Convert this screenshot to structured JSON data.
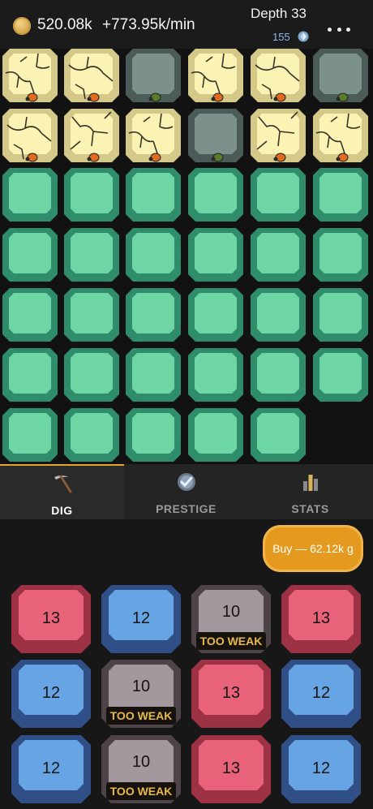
{
  "header": {
    "gold": "520.08k",
    "gold_rate": "+773.95k/min",
    "depth": "Depth 33",
    "gems": "155"
  },
  "mine": {
    "colors": {
      "emerald": "#6ed6a4",
      "cracked_sand": "#fbf3b4",
      "stone": "#7d918c",
      "background": "#121212"
    },
    "rows": [
      [
        "cracked_sand",
        "cracked_sand",
        "stone",
        "cracked_sand",
        "cracked_sand",
        "stone"
      ],
      [
        "cracked_sand",
        "cracked_sand",
        "cracked_sand",
        "stone",
        "cracked_sand",
        "cracked_sand"
      ],
      [
        "emerald",
        "emerald",
        "emerald",
        "emerald",
        "emerald",
        "emerald"
      ],
      [
        "emerald",
        "emerald",
        "emerald",
        "emerald",
        "emerald",
        "emerald"
      ],
      [
        "emerald",
        "emerald",
        "emerald",
        "emerald",
        "emerald",
        "emerald"
      ],
      [
        "emerald",
        "emerald",
        "emerald",
        "emerald",
        "emerald",
        "emerald"
      ],
      [
        "emerald",
        "emerald",
        "emerald",
        "emerald",
        "emerald"
      ]
    ],
    "critters": [
      {
        "row": 0,
        "col": 0,
        "kind": "orange-beetle"
      },
      {
        "row": 0,
        "col": 1,
        "kind": "orange-beetle"
      },
      {
        "row": 0,
        "col": 2,
        "kind": "green-beetle"
      },
      {
        "row": 0,
        "col": 3,
        "kind": "orange-beetle"
      },
      {
        "row": 0,
        "col": 4,
        "kind": "orange-beetle"
      },
      {
        "row": 0,
        "col": 5,
        "kind": "green-beetle"
      },
      {
        "row": 1,
        "col": 0,
        "kind": "orange-beetle"
      },
      {
        "row": 1,
        "col": 1,
        "kind": "orange-beetle"
      },
      {
        "row": 1,
        "col": 2,
        "kind": "orange-beetle"
      },
      {
        "row": 1,
        "col": 3,
        "kind": "green-beetle"
      },
      {
        "row": 1,
        "col": 4,
        "kind": "orange-beetle"
      },
      {
        "row": 1,
        "col": 5,
        "kind": "orange-beetle"
      }
    ]
  },
  "tabs": [
    {
      "label": "DIG",
      "icon": "pickaxe-icon",
      "active": true
    },
    {
      "label": "PRESTIGE",
      "icon": "prestige-badge-icon",
      "active": false
    },
    {
      "label": "STATS",
      "icon": "bar-chart-icon",
      "active": false
    }
  ],
  "dig": {
    "buy_label": "Buy — 62.12k g",
    "too_weak_label": "TOO WEAK",
    "pickaxes": [
      {
        "level": "13",
        "color": "red",
        "too_weak": false
      },
      {
        "level": "12",
        "color": "blue",
        "too_weak": false
      },
      {
        "level": "10",
        "color": "gray",
        "too_weak": true
      },
      {
        "level": "13",
        "color": "red",
        "too_weak": false
      },
      {
        "level": "12",
        "color": "blue",
        "too_weak": false
      },
      {
        "level": "10",
        "color": "gray",
        "too_weak": true
      },
      {
        "level": "13",
        "color": "red",
        "too_weak": false
      },
      {
        "level": "12",
        "color": "blue",
        "too_weak": false
      },
      {
        "level": "12",
        "color": "blue",
        "too_weak": false
      },
      {
        "level": "10",
        "color": "gray",
        "too_weak": true
      },
      {
        "level": "13",
        "color": "red",
        "too_weak": false
      },
      {
        "level": "12",
        "color": "blue",
        "too_weak": false
      }
    ]
  }
}
